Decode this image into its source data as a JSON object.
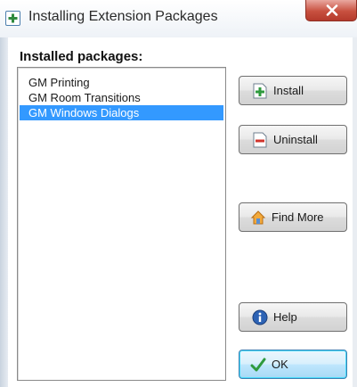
{
  "window": {
    "title": "Installing Extension Packages",
    "title_icon": "plus-icon",
    "close_label": "X"
  },
  "packages": {
    "label": "Installed packages:",
    "items": [
      "GM Printing",
      "GM Room Transitions",
      "GM Windows Dialogs"
    ],
    "selected_index": 2
  },
  "buttons": {
    "install": {
      "label": "Install",
      "icon": "install-icon"
    },
    "uninstall": {
      "label": "Uninstall",
      "icon": "uninstall-icon"
    },
    "find_more": {
      "label": "Find More",
      "icon": "find-more-icon"
    },
    "help": {
      "label": "Help",
      "icon": "info-icon"
    },
    "ok": {
      "label": "OK",
      "icon": "checkmark-icon"
    }
  },
  "colors": {
    "selection": "#3399ff",
    "close_button": "#c8503f",
    "ok_border": "#3c7fb1"
  }
}
